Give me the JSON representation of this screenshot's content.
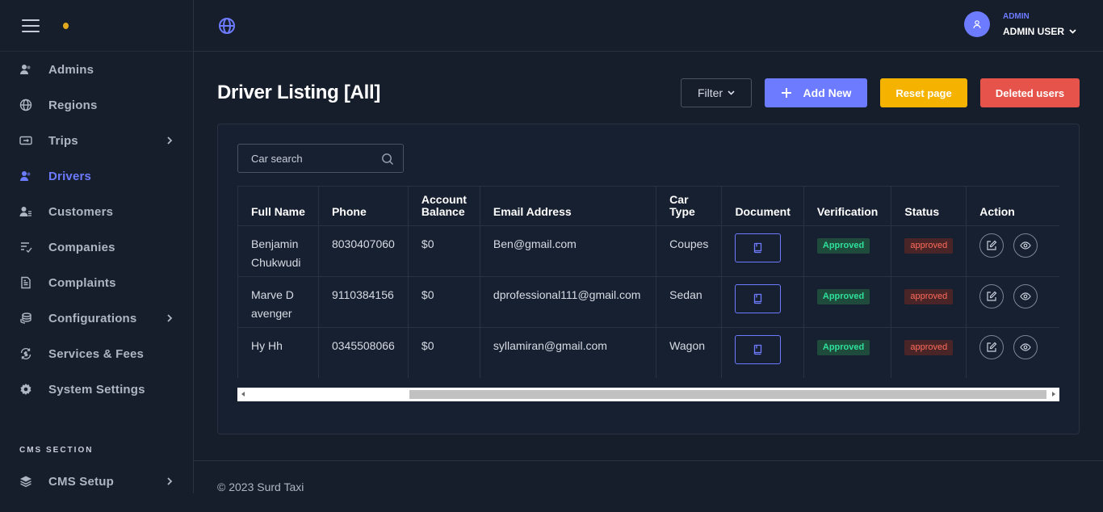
{
  "sidebar": {
    "items": [
      {
        "label": "Admins",
        "icon": "users-icon"
      },
      {
        "label": "Regions",
        "icon": "globe-icon"
      },
      {
        "label": "Trips",
        "icon": "ticket-icon"
      },
      {
        "label": "Drivers",
        "icon": "users-icon"
      },
      {
        "label": "Customers",
        "icon": "user-list-icon"
      },
      {
        "label": "Companies",
        "icon": "list-check-icon"
      },
      {
        "label": "Complaints",
        "icon": "document-icon"
      },
      {
        "label": "Configurations",
        "icon": "coins-icon"
      },
      {
        "label": "Services & Fees",
        "icon": "refresh-money-icon"
      },
      {
        "label": "System Settings",
        "icon": "gear-icon"
      }
    ],
    "cms_section_label": "CMS SECTION",
    "cms_items": [
      {
        "label": "CMS Setup",
        "icon": "layers-icon"
      }
    ]
  },
  "header": {
    "user_role": "ADMIN",
    "user_name": "ADMIN USER"
  },
  "page": {
    "title": "Driver Listing [All]",
    "filter_label": "Filter",
    "add_label": "Add New",
    "reset_label": "Reset page",
    "deleted_label": "Deleted users"
  },
  "search": {
    "placeholder": "Car search"
  },
  "table": {
    "headers": [
      "Full Name",
      "Phone",
      "Account Balance",
      "Email Address",
      "Car Type",
      "Document",
      "Verification",
      "Status",
      "Action"
    ],
    "rows": [
      {
        "name": "Benjamin Chukwudi",
        "phone": "8030407060",
        "balance": "$0",
        "email": "Ben@gmail.com",
        "car_type": "Coupes",
        "verification": "Approved",
        "status": "approved"
      },
      {
        "name": "Marve D avenger",
        "phone": "9110384156",
        "balance": "$0",
        "email": "dprofessional111@gmail.com",
        "car_type": "Sedan",
        "verification": "Approved",
        "status": "approved"
      },
      {
        "name": "Hy Hh",
        "phone": "0345508066",
        "balance": "$0",
        "email": "syllamiran@gmail.com",
        "car_type": "Wagon",
        "verification": "Approved",
        "status": "approved"
      }
    ]
  },
  "footer": {
    "text": "© 2023 Surd Taxi"
  },
  "colors": {
    "accent": "#6c7bff",
    "warning": "#f5b300",
    "danger": "#e5534b",
    "success": "#2ee09a"
  }
}
